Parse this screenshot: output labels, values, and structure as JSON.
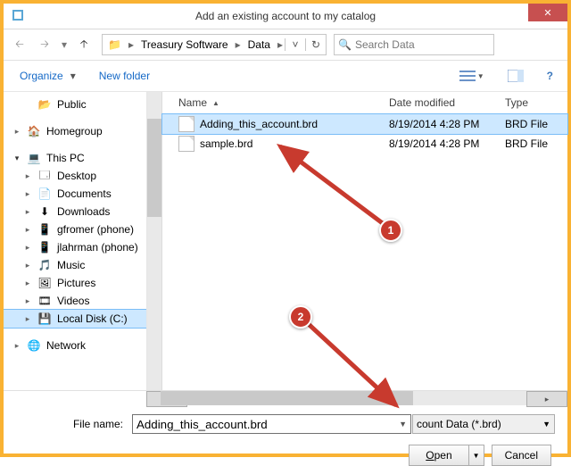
{
  "title": "Add an existing account to my catalog",
  "breadcrumb": {
    "seg1": "Treasury Software",
    "seg2": "Data"
  },
  "search": {
    "placeholder": "Search Data"
  },
  "toolbar": {
    "organize": "Organize",
    "newfolder": "New folder"
  },
  "columns": {
    "name": "Name",
    "date": "Date modified",
    "type": "Type"
  },
  "tree": {
    "public": "Public",
    "homegroup": "Homegroup",
    "thispc": "This PC",
    "desktop": "Desktop",
    "documents": "Documents",
    "downloads": "Downloads",
    "phone1": "gfromer (phone)",
    "phone2": "jlahrman (phone)",
    "music": "Music",
    "pictures": "Pictures",
    "videos": "Videos",
    "cdrive": "Local Disk (C:)",
    "network": "Network"
  },
  "files": [
    {
      "name": "Adding_this_account.brd",
      "date": "8/19/2014 4:28 PM",
      "type": "BRD File",
      "selected": true
    },
    {
      "name": "sample.brd",
      "date": "8/19/2014 4:28 PM",
      "type": "BRD File",
      "selected": false
    }
  ],
  "footer": {
    "filelabel": "File name:",
    "filename": "Adding_this_account.brd",
    "filetype": "count Data (*.brd)",
    "open": "Open",
    "cancel": "Cancel"
  },
  "annotations": {
    "b1": "1",
    "b2": "2"
  }
}
